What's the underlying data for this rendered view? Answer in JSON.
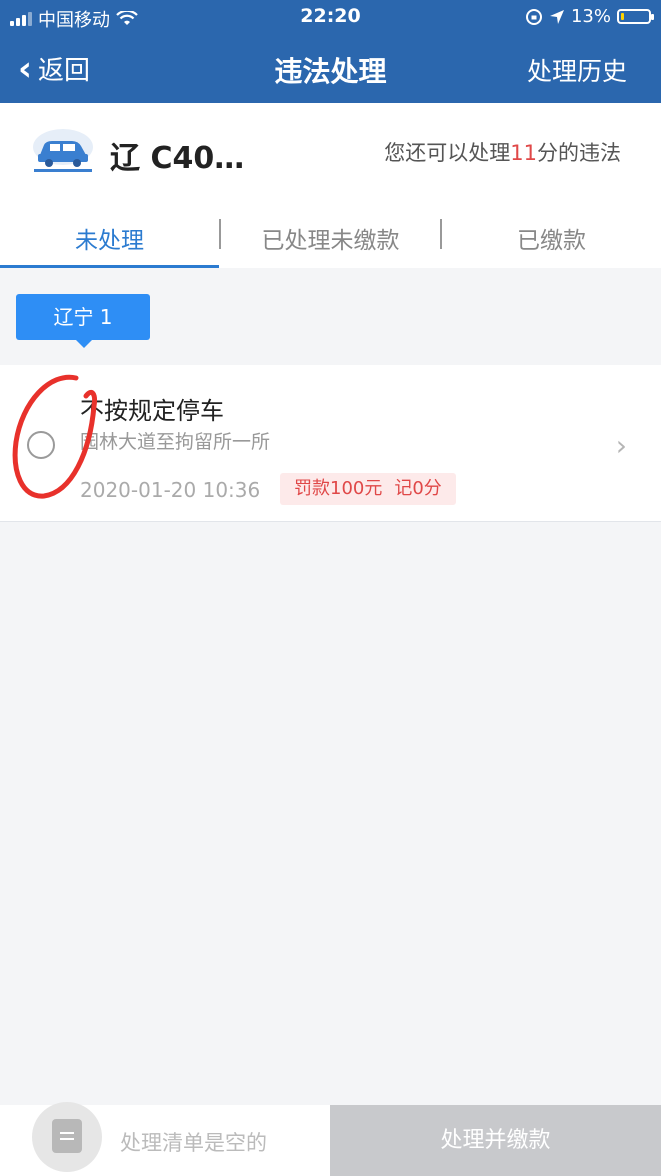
{
  "status_bar": {
    "carrier": "中国移动",
    "time": "22:20",
    "battery": "13%",
    "battery_level": 0.13
  },
  "nav": {
    "back_label": "返回",
    "title": "违法处理",
    "history_label": "处理历史"
  },
  "vehicle": {
    "plate": "辽 C40…",
    "quota_prefix": "您还可以处理",
    "quota_points": "11",
    "quota_suffix": "分的违法"
  },
  "tabs": [
    {
      "label": "未处理",
      "active": true
    },
    {
      "label": "已处理未缴款",
      "active": false
    },
    {
      "label": "已缴款",
      "active": false
    }
  ],
  "province_chip": "辽宁 1",
  "violation": {
    "title": "不按规定停车",
    "location": "园林大道至拘留所一所",
    "time": "2020-01-20 10:36",
    "fine": "罚款100元",
    "points": "记0分"
  },
  "bottom": {
    "cart_text": "处理清单是空的",
    "pay_label": "处理并缴款"
  },
  "colors": {
    "nav_blue": "#2b67ae",
    "tab_active": "#2b7bd0",
    "chip_blue": "#2e8ef5",
    "alert_red": "#e04848"
  }
}
